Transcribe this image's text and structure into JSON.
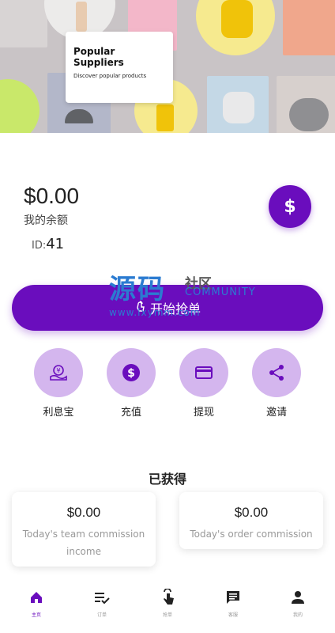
{
  "banner": {
    "title": "Popular Suppliers",
    "subtitle": "Discover popular products"
  },
  "balance": {
    "amount": "$0.00",
    "label": "我的余额",
    "id_label": "ID:",
    "id_value": "41",
    "dollar_icon": "$"
  },
  "watermark": {
    "big": "源码",
    "small": "社区",
    "english": "COMMUNITY",
    "url": "www.lxymm.com"
  },
  "cta": {
    "label": "开始抢单",
    "icon": "tap-icon"
  },
  "actions": [
    {
      "label": "利息宝",
      "icon": "interest-treasure-icon"
    },
    {
      "label": "充值",
      "icon": "dollar-circle-icon"
    },
    {
      "label": "提现",
      "icon": "card-icon"
    },
    {
      "label": "邀请",
      "icon": "share-icon"
    }
  ],
  "earned": {
    "title": "已获得",
    "cards": [
      {
        "value": "$0.00",
        "label": "Today's team commission income"
      },
      {
        "value": "$0.00",
        "label": "Today's order commission"
      }
    ]
  },
  "nav": [
    {
      "label": "主页",
      "icon": "home-icon",
      "active": true
    },
    {
      "label": "订单",
      "icon": "orders-icon",
      "active": false
    },
    {
      "label": "抢单",
      "icon": "grab-order-icon",
      "active": false
    },
    {
      "label": "客服",
      "icon": "chat-icon",
      "active": false
    },
    {
      "label": "我的",
      "icon": "profile-icon",
      "active": false
    }
  ],
  "colors": {
    "accent": "#6a0dbd",
    "accent_light": "#d4b6ee"
  }
}
